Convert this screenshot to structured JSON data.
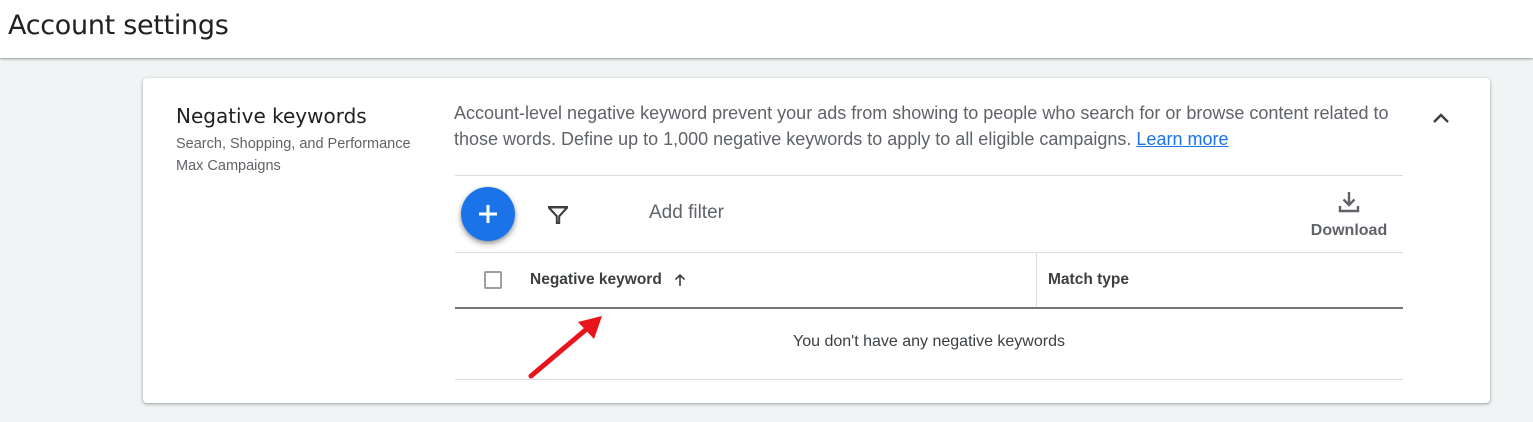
{
  "header": {
    "title": "Account settings"
  },
  "negative_keywords": {
    "title": "Negative keywords",
    "subtitle": "Search, Shopping, and Performance Max Campaigns",
    "description": "Account-level negative keyword prevent your ads from showing to people who search for or browse content related to those words. Define up to 1,000 negative keywords to apply to all eligible campaigns.",
    "learn_more": "Learn more",
    "collapse_icon": "chevron-up-icon",
    "toolbar": {
      "add_icon": "plus-icon",
      "filter_icon": "funnel-icon",
      "add_filter_label": "Add filter",
      "download_icon": "download-icon",
      "download_label": "Download"
    },
    "table": {
      "columns": [
        "Negative keyword",
        "Match type"
      ],
      "sort_icon": "arrow-up-icon",
      "empty_message": "You don't have any negative keywords"
    }
  },
  "colors": {
    "accent": "#1a73e8",
    "annotation_arrow": "#e8141c",
    "page_background": "#f1f3f4"
  }
}
